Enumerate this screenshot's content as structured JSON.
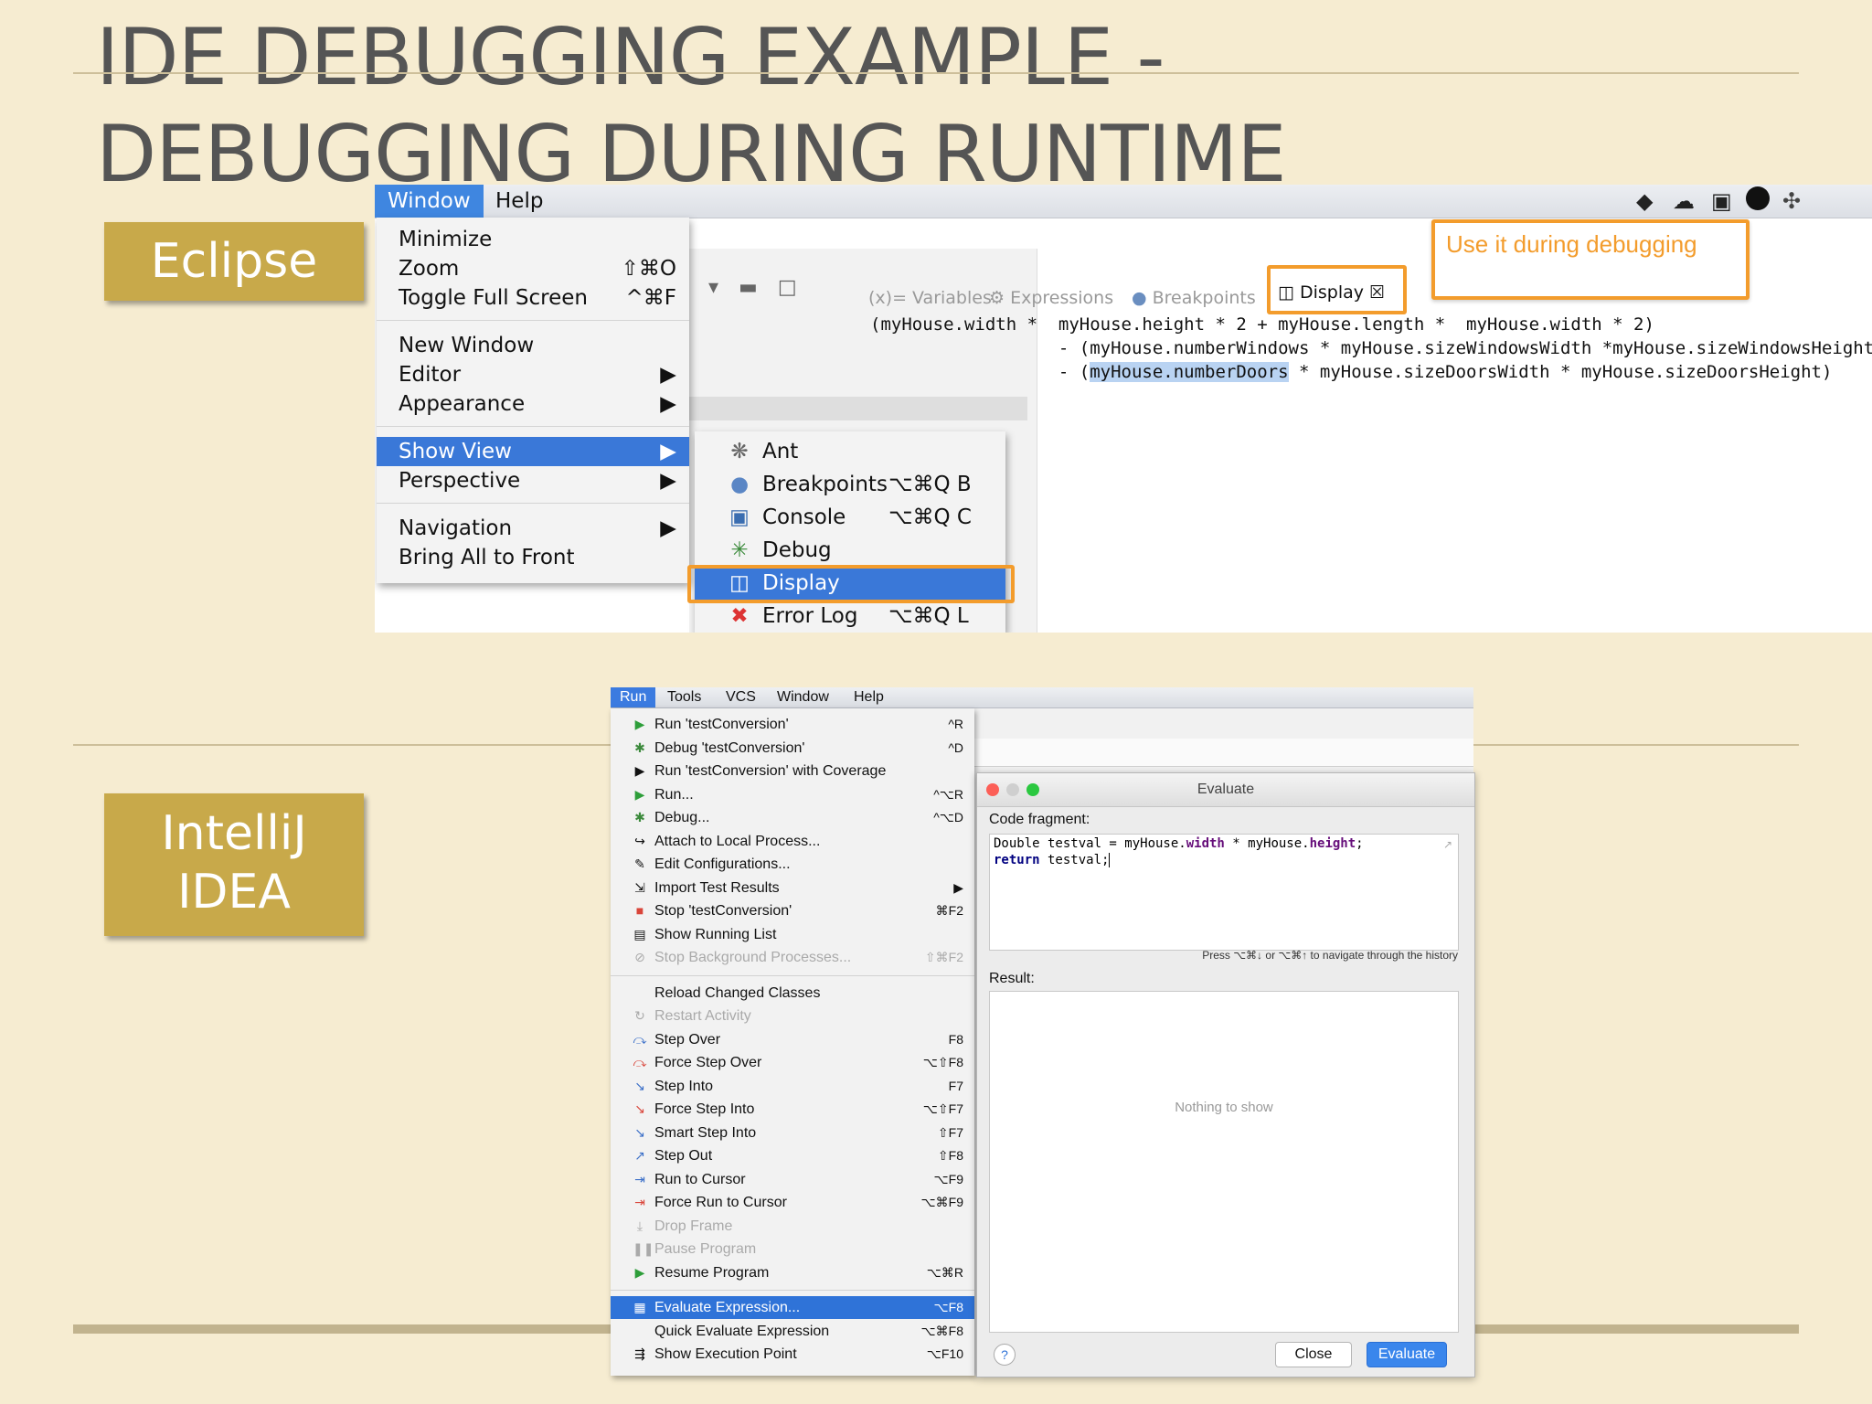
{
  "slide": {
    "title_line1": "IDE DEBUGGING EXAMPLE -",
    "title_line2": "DEBUGGING DURING RUNTIME",
    "label_eclipse": "Eclipse",
    "label_intellij_1": "IntelliJ",
    "label_intellij_2": "IDEA"
  },
  "eclipse": {
    "menubar": [
      "Window",
      "Help"
    ],
    "window_menu": [
      {
        "label": "Minimize",
        "shortcut": ""
      },
      {
        "label": "Zoom",
        "shortcut": "⇧⌘O"
      },
      {
        "label": "Toggle Full Screen",
        "shortcut": "^⌘F"
      },
      {
        "label": "New Window",
        "shortcut": ""
      },
      {
        "label": "Editor",
        "shortcut": "▶"
      },
      {
        "label": "Appearance",
        "shortcut": "▶"
      },
      {
        "label": "Show View",
        "shortcut": "▶"
      },
      {
        "label": "Perspective",
        "shortcut": "▶"
      },
      {
        "label": "Navigation",
        "shortcut": "▶"
      },
      {
        "label": "Bring All to Front",
        "shortcut": ""
      }
    ],
    "show_view_submenu": [
      {
        "label": "Ant",
        "shortcut": "",
        "icon": "ant-icon"
      },
      {
        "label": "Breakpoints",
        "shortcut": "⌥⌘Q B",
        "icon": "breakpoints-icon"
      },
      {
        "label": "Console",
        "shortcut": "⌥⌘Q C",
        "icon": "console-icon"
      },
      {
        "label": "Debug",
        "shortcut": "",
        "icon": "debug-icon"
      },
      {
        "label": "Display",
        "shortcut": "",
        "icon": "display-icon"
      },
      {
        "label": "Error Log",
        "shortcut": "⌥⌘Q L",
        "icon": "error-log-icon"
      }
    ],
    "view_tabs": [
      "(x)= Variables",
      "Expressions",
      "Breakpoints",
      "Display"
    ],
    "callout": "Use it during debugging",
    "code_lines": [
      "(myHouse.width *  myHouse.height * 2 + myHouse.length *  myHouse.width * 2)",
      "                  - (myHouse.numberWindows * myHouse.sizeWindowsWidth *myHouse.sizeWindowsHeight",
      "                  - ("
    ],
    "code_highlight": "myHouse.numberDoors",
    "code_line3_rest": " * myHouse.sizeDoorsWidth * myHouse.sizeDoorsHeight)",
    "accent_color": "#f39c2c",
    "selection_color": "#3a78d8"
  },
  "intellij": {
    "menubar": [
      "Run",
      "Tools",
      "VCS",
      "Window",
      "Help"
    ],
    "run_menu": [
      {
        "label": "Run 'testConversion'",
        "shortcut": "^R",
        "icon": "run-icon",
        "disabled": false
      },
      {
        "label": "Debug 'testConversion'",
        "shortcut": "^D",
        "icon": "debug-icon",
        "disabled": false
      },
      {
        "label": "Run 'testConversion' with Coverage",
        "shortcut": "",
        "icon": "coverage-icon",
        "disabled": false
      },
      {
        "label": "Run...",
        "shortcut": "^⌥R",
        "icon": "run-icon",
        "disabled": false
      },
      {
        "label": "Debug...",
        "shortcut": "^⌥D",
        "icon": "debug-icon",
        "disabled": false
      },
      {
        "label": "Attach to Local Process...",
        "shortcut": "",
        "icon": "attach-icon",
        "disabled": false
      },
      {
        "label": "Edit Configurations...",
        "shortcut": "",
        "icon": "edit-config-icon",
        "disabled": false
      },
      {
        "label": "Import Test Results",
        "shortcut": "▶",
        "icon": "import-icon",
        "disabled": false
      },
      {
        "label": "Stop 'testConversion'",
        "shortcut": "⌘F2",
        "icon": "stop-icon",
        "disabled": false
      },
      {
        "label": "Show Running List",
        "shortcut": "",
        "icon": "list-icon",
        "disabled": false
      },
      {
        "label": "Stop Background Processes...",
        "shortcut": "⇧⌘F2",
        "icon": "stop-bg-icon",
        "disabled": true
      },
      {
        "label": "Reload Changed Classes",
        "shortcut": "",
        "icon": "",
        "disabled": false
      },
      {
        "label": "Restart Activity",
        "shortcut": "",
        "icon": "restart-icon",
        "disabled": true
      },
      {
        "label": "Step Over",
        "shortcut": "F8",
        "icon": "step-over-icon",
        "disabled": false
      },
      {
        "label": "Force Step Over",
        "shortcut": "⌥⇧F8",
        "icon": "force-step-over-icon",
        "disabled": false
      },
      {
        "label": "Step Into",
        "shortcut": "F7",
        "icon": "step-into-icon",
        "disabled": false
      },
      {
        "label": "Force Step Into",
        "shortcut": "⌥⇧F7",
        "icon": "force-step-into-icon",
        "disabled": false
      },
      {
        "label": "Smart Step Into",
        "shortcut": "⇧F7",
        "icon": "smart-step-into-icon",
        "disabled": false
      },
      {
        "label": "Step Out",
        "shortcut": "⇧F8",
        "icon": "step-out-icon",
        "disabled": false
      },
      {
        "label": "Run to Cursor",
        "shortcut": "⌥F9",
        "icon": "run-to-cursor-icon",
        "disabled": false
      },
      {
        "label": "Force Run to Cursor",
        "shortcut": "⌥⌘F9",
        "icon": "force-run-to-cursor-icon",
        "disabled": false
      },
      {
        "label": "Drop Frame",
        "shortcut": "",
        "icon": "drop-frame-icon",
        "disabled": true
      },
      {
        "label": "Pause Program",
        "shortcut": "",
        "icon": "pause-icon",
        "disabled": true
      },
      {
        "label": "Resume Program",
        "shortcut": "⌥⌘R",
        "icon": "resume-icon",
        "disabled": false
      },
      {
        "label": "Evaluate Expression...",
        "shortcut": "⌥F8",
        "icon": "evaluate-icon",
        "disabled": false
      },
      {
        "label": "Quick Evaluate Expression",
        "shortcut": "⌥⌘F8",
        "icon": "",
        "disabled": false
      },
      {
        "label": "Show Execution Point",
        "shortcut": "⌥F10",
        "icon": "execution-point-icon",
        "disabled": false
      }
    ],
    "dialog": {
      "title": "Evaluate",
      "code_fragment_label": "Code fragment:",
      "code_line1_a": "Double testval = myHouse.",
      "code_line1_b": "width",
      "code_line1_c": " * myHouse.",
      "code_line1_d": "height",
      "code_line1_e": ";",
      "code_line2_kw": "return",
      "code_line2_rest": " testval;",
      "history_hint": "Press ⌥⌘↓ or ⌥⌘↑ to navigate through the history",
      "result_label": "Result:",
      "empty_text": "Nothing to show",
      "help": "?",
      "close_button": "Close",
      "evaluate_button": "Evaluate"
    }
  }
}
